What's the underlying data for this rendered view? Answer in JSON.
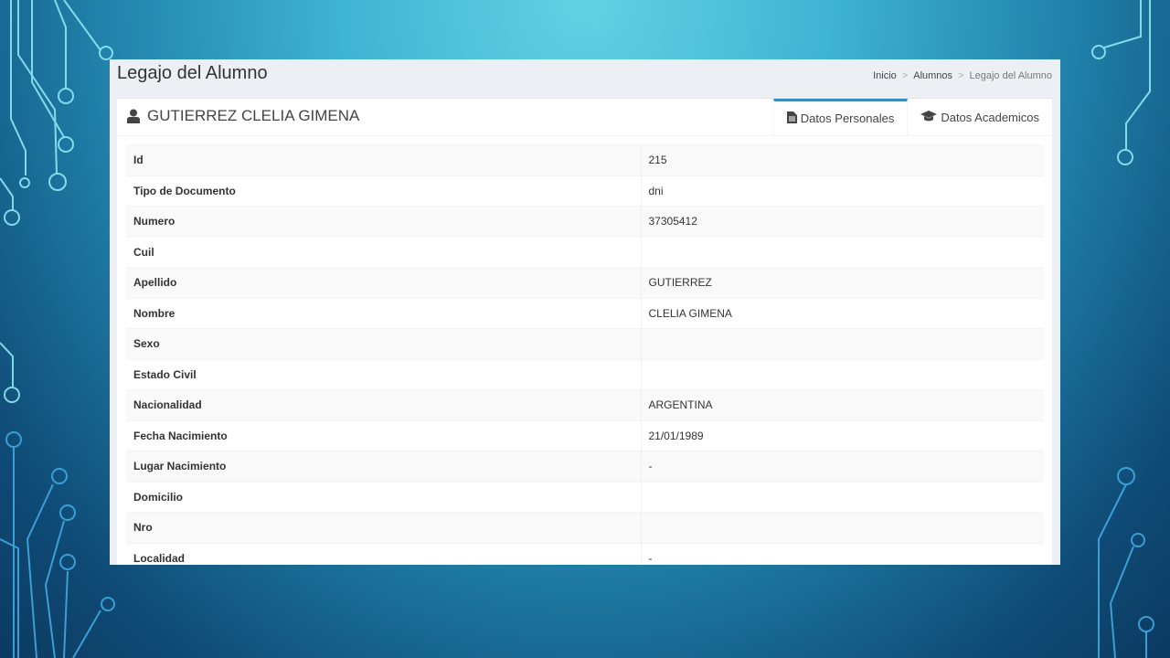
{
  "page": {
    "title": "Legajo del Alumno",
    "breadcrumb": [
      "Inicio",
      "Alumnos",
      "Legajo del Alumno"
    ]
  },
  "student": {
    "name": "GUTIERREZ CLELIA GIMENA",
    "icon": "user-icon"
  },
  "tabs": [
    {
      "label": "Datos Personales",
      "icon": "file-text-icon",
      "active": true
    },
    {
      "label": "Datos Academicos",
      "icon": "graduation-cap-icon",
      "active": false
    }
  ],
  "fields": [
    {
      "label": "Id",
      "value": "215"
    },
    {
      "label": "Tipo de Documento",
      "value": "dni"
    },
    {
      "label": "Numero",
      "value": "37305412"
    },
    {
      "label": "Cuil",
      "value": ""
    },
    {
      "label": "Apellido",
      "value": "GUTIERREZ"
    },
    {
      "label": "Nombre",
      "value": "CLELIA GIMENA"
    },
    {
      "label": "Sexo",
      "value": ""
    },
    {
      "label": "Estado Civil",
      "value": ""
    },
    {
      "label": "Nacionalidad",
      "value": "ARGENTINA"
    },
    {
      "label": "Fecha Nacimiento",
      "value": "21/01/1989"
    },
    {
      "label": "Lugar Nacimiento",
      "value": "-"
    },
    {
      "label": "Domicilio",
      "value": ""
    },
    {
      "label": "Nro",
      "value": ""
    },
    {
      "label": "Localidad",
      "value": "-"
    }
  ],
  "colors": {
    "accent": "#3c8dbc",
    "slide_background_top": "#62d2e3",
    "slide_background_bottom": "#0c3a60"
  }
}
